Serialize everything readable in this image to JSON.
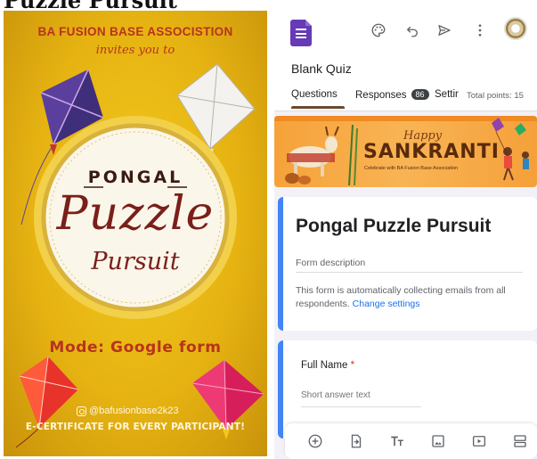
{
  "top_title": "Puzzle Pursuit",
  "poster": {
    "org": "BA FUSION BASE ASSOCISTION",
    "invites": "invites you to",
    "pongal": "PONGAL",
    "puzzle": "Puzzle",
    "pursuit": "Pursuit",
    "mode": "Mode: Google form",
    "handle": "@bafusionbase2k23",
    "certificate": "E-CERTIFICATE FOR EVERY PARTICIPANT!",
    "colors": {
      "background": "#e6b312",
      "accent": "#b8331e",
      "title": "#7a1f1a"
    }
  },
  "app": {
    "toolbar": {
      "icons": [
        "palette-icon",
        "undo-icon",
        "send-icon",
        "more-vert-icon"
      ]
    },
    "quiz_title": "Blank Quiz",
    "tabs": [
      {
        "label": "Questions"
      },
      {
        "label": "Responses",
        "badge": "86"
      },
      {
        "label": "Settir"
      }
    ],
    "total_points": "Total points: 15",
    "banner": {
      "happy": "Happy",
      "title": "SANKRANTI",
      "subtitle": "Celebrate with BA Fusion Base Association"
    },
    "form": {
      "title": "Pongal Puzzle Pursuit",
      "description_placeholder": "Form description",
      "collect_note": "This form is automatically collecting emails from all respondents.",
      "change_link": "Change settings"
    },
    "question": {
      "label": "Full Name",
      "required_mark": "*",
      "placeholder": "Short answer text"
    },
    "bottom_icons": [
      "add-question-icon",
      "import-questions-icon",
      "add-title-icon",
      "add-image-icon",
      "add-video-icon",
      "add-section-icon"
    ],
    "colors": {
      "form_purple": "#673ab7",
      "card_accent": "#4285f4",
      "link": "#1a73e8",
      "required": "#d93025"
    }
  }
}
